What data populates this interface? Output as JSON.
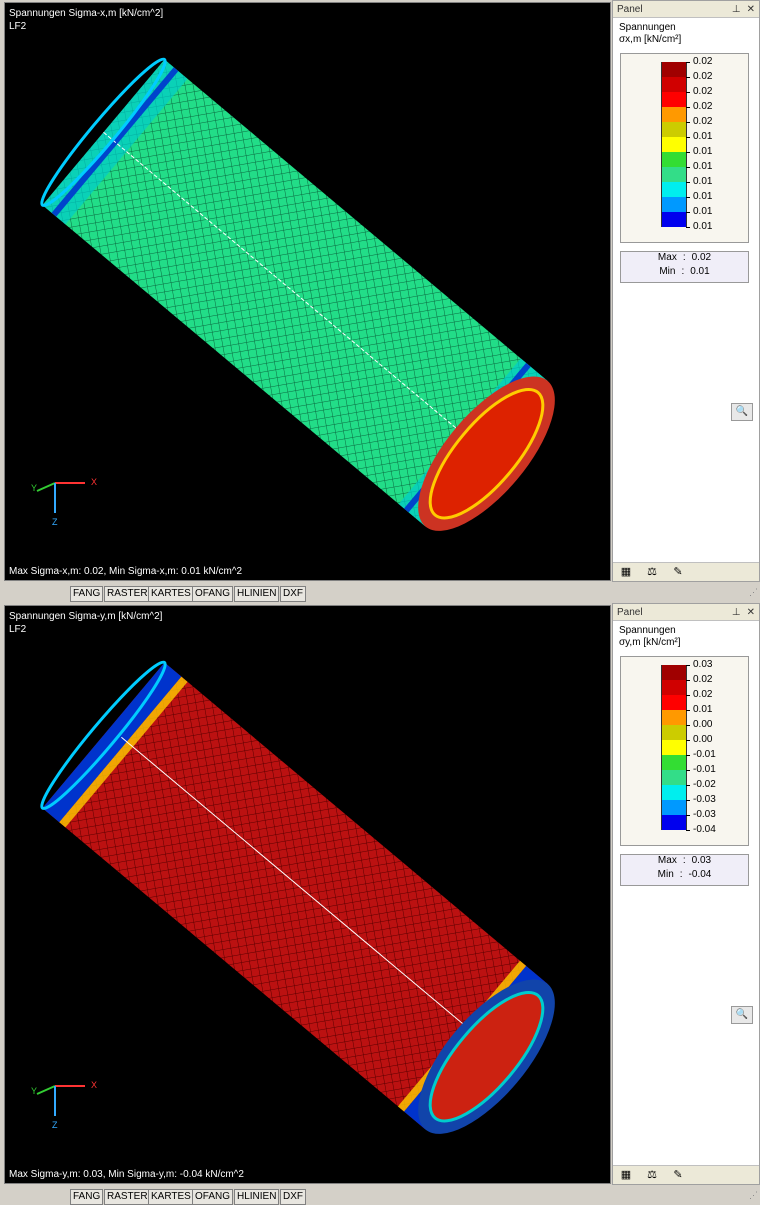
{
  "top": {
    "title": "Spannungen Sigma-x,m [kN/cm^2]",
    "case": "LF2",
    "status": "Max Sigma-x,m: 0.02, Min Sigma-x,m: 0.01 kN/cm^2",
    "panel": {
      "title": "Panel",
      "label": "Spannungen",
      "unit": "σx,m [kN/cm²]",
      "legend": [
        "0.02",
        "0.02",
        "0.02",
        "0.02",
        "0.02",
        "0.01",
        "0.01",
        "0.01",
        "0.01",
        "0.01",
        "0.01",
        "0.01"
      ],
      "max_label": "Max",
      "max_value": "0.02",
      "min_label": "Min",
      "min_value": "0.01"
    }
  },
  "bottom": {
    "title": "Spannungen Sigma-y,m [kN/cm^2]",
    "case": "LF2",
    "status": "Max Sigma-y,m: 0.03, Min Sigma-y,m: -0.04 kN/cm^2",
    "panel": {
      "title": "Panel",
      "label": "Spannungen",
      "unit": "σy,m [kN/cm²]",
      "legend": [
        "0.03",
        "0.02",
        "0.02",
        "0.01",
        "0.00",
        "0.00",
        "-0.01",
        "-0.01",
        "-0.02",
        "-0.03",
        "-0.03",
        "-0.04"
      ],
      "max_label": "Max",
      "max_value": "0.03",
      "min_label": "Min",
      "min_value": "-0.04"
    }
  },
  "axes": {
    "x": "X",
    "y": "Y",
    "z": "Z"
  },
  "colors": {
    "scale": [
      "#a00000",
      "#d00000",
      "#ff0000",
      "#ff9900",
      "#cccc00",
      "#ffff00",
      "#33dd33",
      "#33dd88",
      "#00eeee",
      "#0099ff",
      "#0000ee",
      "#000099"
    ],
    "top_fill": "#22dd88",
    "bottom_fill": "#bb1111"
  },
  "statusbar": {
    "buttons": [
      "FANG",
      "RASTER",
      "KARTES",
      "OFANG",
      "HLINIEN",
      "DXF"
    ]
  },
  "icons": [
    "panel-color-icon",
    "panel-scale-icon",
    "panel-edit-icon",
    "zoom-icon",
    "pin-icon",
    "close-icon"
  ]
}
